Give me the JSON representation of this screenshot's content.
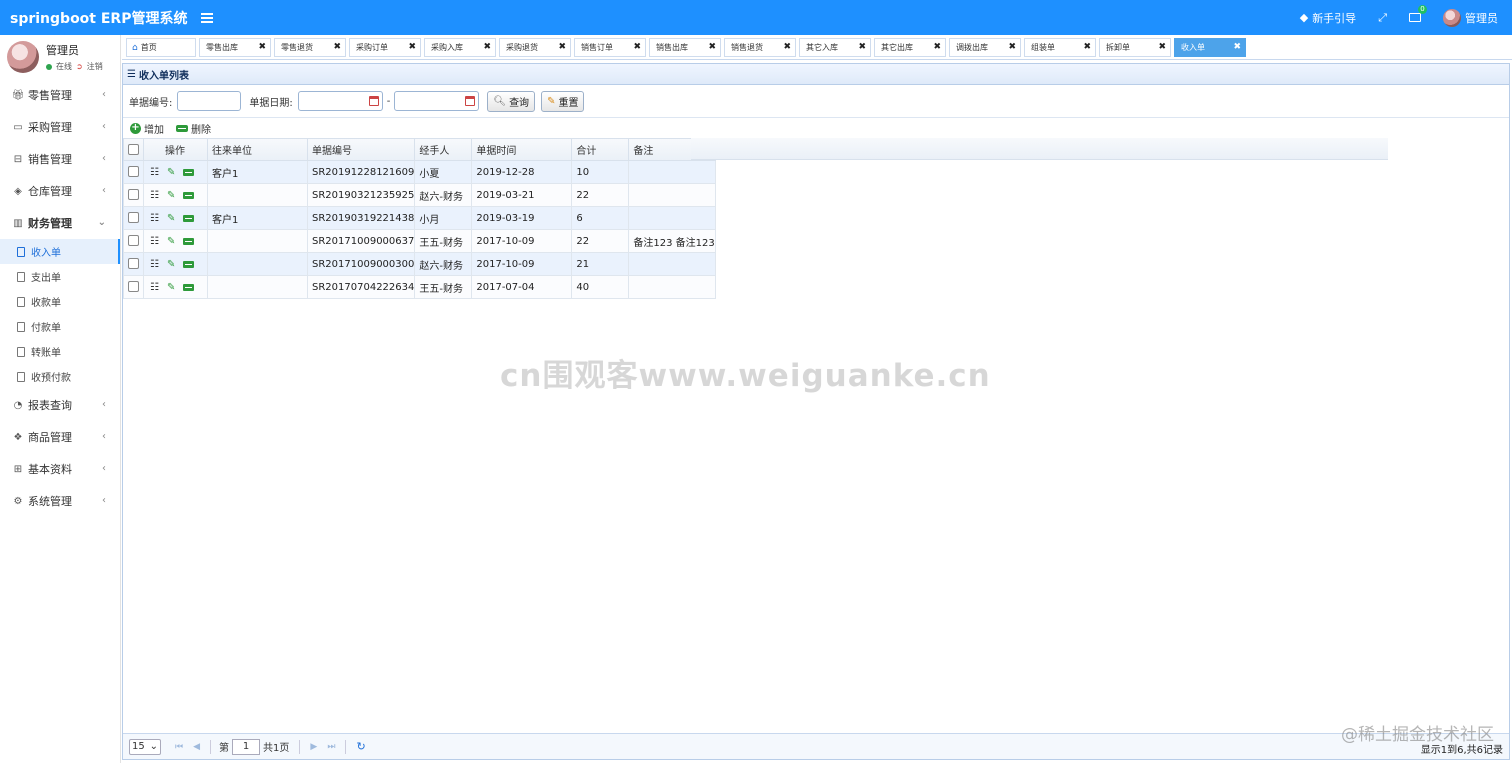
{
  "app": {
    "title": "springboot ERP管理系统",
    "accent": "#1e90ff"
  },
  "topbar": {
    "guide_label": "新手引导",
    "mail_badge": "0",
    "user_label": "管理员"
  },
  "sidebar": {
    "user_name": "管理员",
    "status_online": "在线",
    "logout_label": "注销",
    "menu": [
      {
        "label": "零售管理"
      },
      {
        "label": "采购管理"
      },
      {
        "label": "销售管理"
      },
      {
        "label": "仓库管理"
      },
      {
        "label": "财务管理"
      }
    ],
    "finance_sub": [
      {
        "label": "收入单"
      },
      {
        "label": "支出单"
      },
      {
        "label": "收款单"
      },
      {
        "label": "付款单"
      },
      {
        "label": "转账单"
      },
      {
        "label": "收预付款"
      }
    ],
    "menu_after": [
      {
        "label": "报表查询"
      },
      {
        "label": "商品管理"
      },
      {
        "label": "基本资料"
      },
      {
        "label": "系统管理"
      }
    ]
  },
  "tabs": [
    {
      "label": "首页"
    },
    {
      "label": "零售出库"
    },
    {
      "label": "零售退货"
    },
    {
      "label": "采购订单"
    },
    {
      "label": "采购入库"
    },
    {
      "label": "采购退货"
    },
    {
      "label": "销售订单"
    },
    {
      "label": "销售出库"
    },
    {
      "label": "销售退货"
    },
    {
      "label": "其它入库"
    },
    {
      "label": "其它出库"
    },
    {
      "label": "调拨出库"
    },
    {
      "label": "组装单"
    },
    {
      "label": "拆卸单"
    },
    {
      "label": "收入单"
    }
  ],
  "panel": {
    "title": "收入单列表",
    "search": {
      "number_label": "单据编号:",
      "date_label": "单据日期:",
      "dash": "-",
      "query_label": "查询",
      "reset_label": "重置"
    },
    "toolbar": {
      "add_label": "增加",
      "delete_label": "删除"
    },
    "columns": [
      "操作",
      "往来单位",
      "单据编号",
      "经手人",
      "单据时间",
      "合计",
      "备注"
    ],
    "rows": [
      {
        "unit": "客户1",
        "number": "SR20191228121609",
        "handler": "小夏",
        "time": "2019-12-28",
        "total": "10",
        "remark": ""
      },
      {
        "unit": "",
        "number": "SR20190321235925",
        "handler": "赵六-财务",
        "time": "2019-03-21",
        "total": "22",
        "remark": ""
      },
      {
        "unit": "客户1",
        "number": "SR20190319221438",
        "handler": "小月",
        "time": "2019-03-19",
        "total": "6",
        "remark": ""
      },
      {
        "unit": "",
        "number": "SR20171009000637",
        "handler": "王五-财务",
        "time": "2017-10-09",
        "total": "22",
        "remark": "备注123 备注123"
      },
      {
        "unit": "",
        "number": "SR20171009000300",
        "handler": "赵六-财务",
        "time": "2017-10-09",
        "total": "21",
        "remark": ""
      },
      {
        "unit": "",
        "number": "SR20170704222634",
        "handler": "王五-财务",
        "time": "2017-07-04",
        "total": "40",
        "remark": ""
      }
    ]
  },
  "pager": {
    "page_size": "15",
    "page_prefix": "第",
    "page_value": "1",
    "page_total": "共1页",
    "info": "显示1到6,共6记录"
  },
  "watermarks": {
    "center": "cn围观客www.weiguanke.cn",
    "corner": "@稀土掘金技术社区"
  }
}
